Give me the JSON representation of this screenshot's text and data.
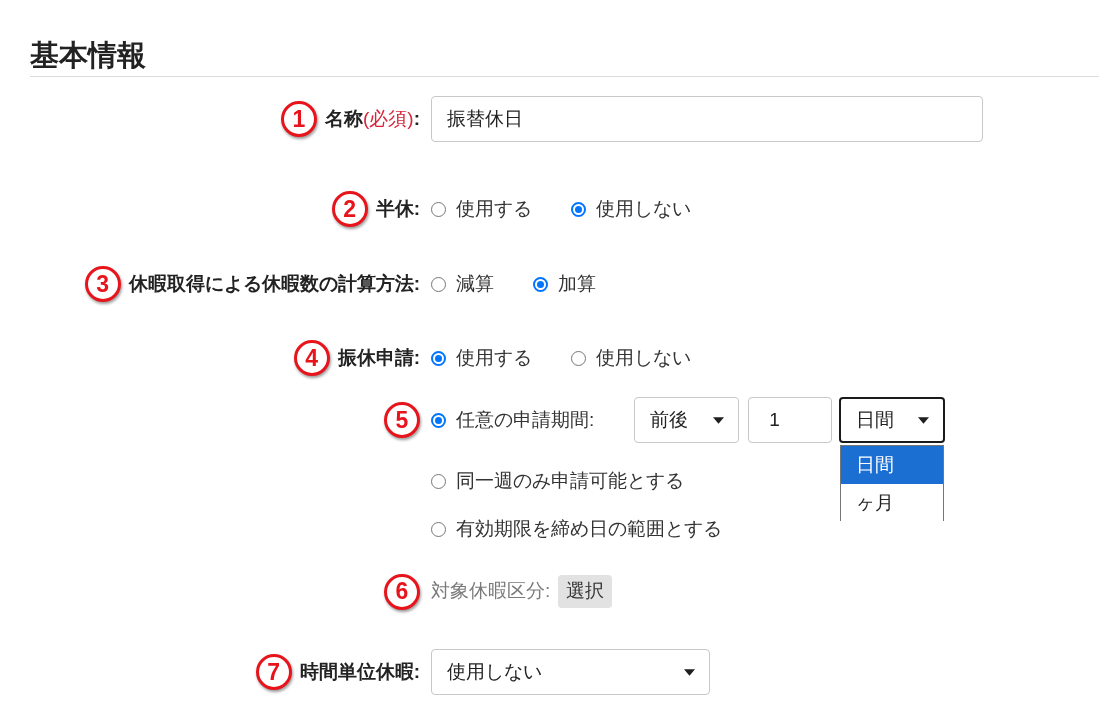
{
  "section": {
    "title": "基本情報"
  },
  "fields": [
    {
      "kind": "text",
      "badge": "1",
      "label": "名称",
      "required_mark": "(必須)",
      "label_end": ":",
      "value": "振替休日"
    },
    {
      "kind": "radio",
      "badge": "2",
      "label": "半休:",
      "options": [
        {
          "label": "使用する",
          "selected": false
        },
        {
          "label": "使用しない",
          "selected": true
        }
      ]
    },
    {
      "kind": "radio",
      "badge": "3",
      "label": "休暇取得による休暇数の計算方法:",
      "options": [
        {
          "label": "減算",
          "selected": false
        },
        {
          "label": "加算",
          "selected": true
        }
      ]
    },
    {
      "kind": "radio",
      "badge": "4",
      "label": "振休申請:",
      "options": [
        {
          "label": "使用する",
          "selected": true
        },
        {
          "label": "使用しない",
          "selected": false
        }
      ]
    },
    {
      "kind": "period",
      "badge": "5",
      "choices": [
        {
          "kind": "period",
          "label": "任意の申請期間:",
          "selected": true,
          "direction": {
            "value": "前後",
            "expanded": false
          },
          "amount": "1",
          "unit": {
            "value": "日間",
            "expanded": true,
            "options": [
              {
                "label": "日間",
                "selected": true
              },
              {
                "label": "ヶ月",
                "selected": false
              }
            ]
          }
        },
        {
          "kind": "plain",
          "label": "同一週のみ申請可能とする",
          "selected": false
        },
        {
          "kind": "plain",
          "label": "有効期限を締め日の範囲とする",
          "selected": false
        }
      ]
    },
    {
      "kind": "picker",
      "badge": "6",
      "label": "対象休暇区分:",
      "button": "選択"
    },
    {
      "kind": "select",
      "badge": "7",
      "label": "時間単位休暇:",
      "select": {
        "value": "使用しない",
        "expanded": false
      }
    }
  ]
}
